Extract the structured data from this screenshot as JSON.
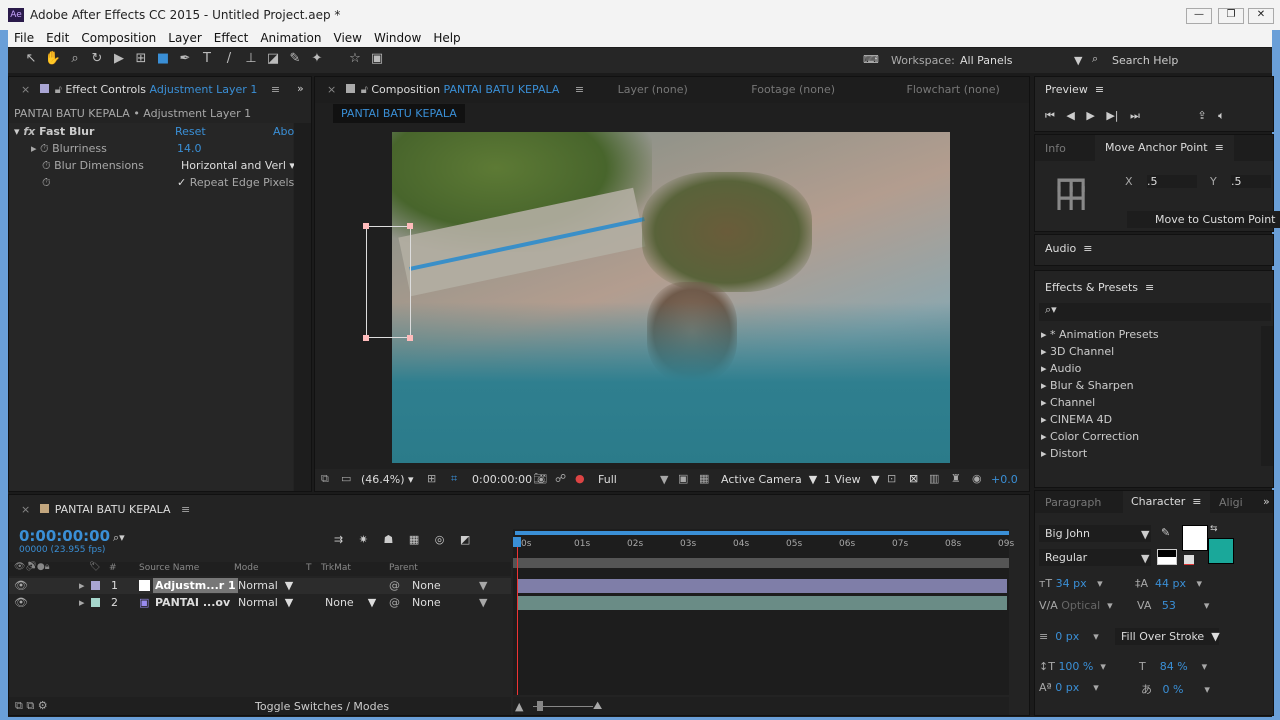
{
  "window": {
    "app_icon": "Ae",
    "title": "Adobe After Effects CC 2015 - Untitled Project.aep *",
    "controls": [
      "—",
      "❐",
      "✕"
    ]
  },
  "menu": [
    "File",
    "Edit",
    "Composition",
    "Layer",
    "Effect",
    "Animation",
    "View",
    "Window",
    "Help"
  ],
  "toolbar": {
    "workspace_label": "Workspace:",
    "workspace_value": "All Panels",
    "search_help": "Search Help"
  },
  "effect_controls": {
    "tab": "Effect Controls",
    "tab_target": "Adjustment Layer 1",
    "breadcrumb": "PANTAI BATU KEPALA • Adjustment Layer 1",
    "effect": "Fast Blur",
    "reset": "Reset",
    "about": "Abo",
    "props": [
      {
        "name": "Blurriness",
        "value": "14.0"
      },
      {
        "name": "Blur Dimensions",
        "value": "Horizontal and Verl"
      }
    ],
    "checkbox": "Repeat Edge Pixels"
  },
  "composition": {
    "tab": "Composition",
    "tab_target": "PANTAI BATU KEPALA",
    "other_tabs": [
      "Layer (none)",
      "Footage (none)",
      "Flowchart (none)"
    ],
    "comp_label": "PANTAI BATU KEPALA",
    "zoom": "(46.4%)",
    "timecode": "0:00:00:00",
    "resolution": "Full",
    "camera": "Active Camera",
    "views": "1 View",
    "exposure": "+0.0"
  },
  "preview": {
    "title": "Preview"
  },
  "info": {
    "tab": "Info",
    "tab2": "Move Anchor Point",
    "x_label": "X",
    "x_value": ".5",
    "y_label": "Y",
    "y_value": ".5",
    "button": "Move to Custom Point"
  },
  "audio": {
    "title": "Audio"
  },
  "effects_presets": {
    "title": "Effects & Presets",
    "search_placeholder": "",
    "items": [
      "* Animation Presets",
      "3D Channel",
      "Audio",
      "Blur & Sharpen",
      "Channel",
      "CINEMA 4D",
      "Color Correction",
      "Distort"
    ]
  },
  "timeline": {
    "tab": "PANTAI BATU KEPALA",
    "timecode": "0:00:00:00",
    "fps": "00000 (23.955 fps)",
    "columns": [
      "#",
      "Source Name",
      "Mode",
      "T",
      "TrkMat",
      "Parent"
    ],
    "layers": [
      {
        "num": "1",
        "name": "Adjustm...r 1",
        "mode": "Normal",
        "trkmat": "",
        "parent": "None",
        "color": "#a9a5d3"
      },
      {
        "num": "2",
        "name": "PANTAI ...ov",
        "mode": "Normal",
        "trkmat": "None",
        "parent": "None",
        "color": "#a6d6cc"
      }
    ],
    "ruler": [
      "0s",
      "01s",
      "02s",
      "03s",
      "04s",
      "05s",
      "06s",
      "07s",
      "08s",
      "09s"
    ],
    "toggle": "Toggle Switches / Modes"
  },
  "character": {
    "tabs": [
      "Paragraph",
      "Character",
      "Aligi"
    ],
    "font": "Big John",
    "style": "Regular",
    "size": "34 px",
    "leading": "44 px",
    "kerning": "Optical",
    "tracking": "53",
    "stroke": "0 px",
    "stroke_type": "Fill Over Stroke",
    "vscale": "100 %",
    "hscale": "84 %",
    "baseline": "0 px",
    "tsume": "0 %",
    "fill_color": "#ffffff",
    "stroke_color": "#1aa89a"
  }
}
